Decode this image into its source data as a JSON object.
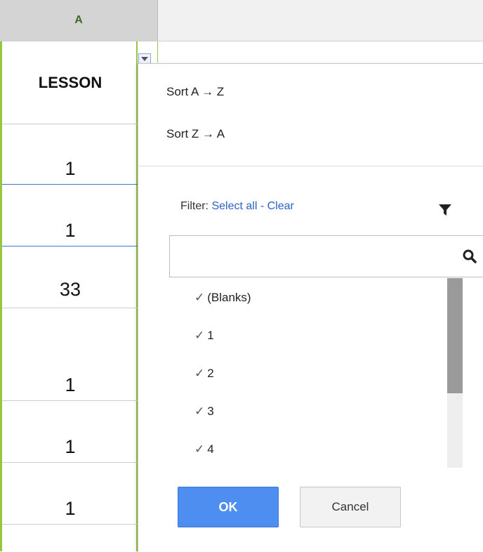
{
  "sheet": {
    "column_header": "A",
    "cells": [
      "LESSON",
      "1",
      "1",
      "33",
      "1",
      "1",
      "1"
    ]
  },
  "menu": {
    "sort_asc": "Sort A → Z",
    "sort_desc": "Sort Z → A",
    "filter_prefix": "Filter:",
    "select_all": "Select all",
    "separator": "-",
    "clear": "Clear",
    "search_value": "",
    "items": [
      "(Blanks)",
      "1",
      "2",
      "3",
      "4"
    ],
    "ok_label": "OK",
    "cancel_label": "Cancel"
  },
  "colors": {
    "accent": "#4d8ef0",
    "link": "#2a62c9",
    "column_border": "#97c63e"
  }
}
